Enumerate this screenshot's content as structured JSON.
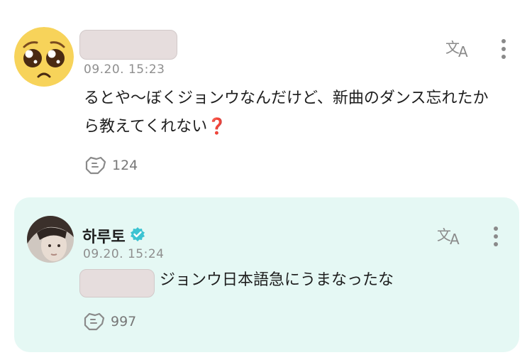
{
  "comments": [
    {
      "author_redacted": true,
      "avatar": "pleading-face-emoji",
      "timestamp": "09.20. 15:23",
      "message": "るとや〜ぼくジョンウなんだけど、新曲のダンス忘れたから教えてくれない",
      "message_emoji": "❓",
      "likes": "124",
      "icons": [
        "translate-icon",
        "more-options-icon",
        "heart-outline-icon"
      ]
    }
  ],
  "reply": {
    "author": "하루토",
    "verified": true,
    "avatar": "profile-photo",
    "timestamp": "09.20. 15:24",
    "mention_redacted": true,
    "message": "ジョンウ日本語急にうまなったな",
    "likes": "997",
    "background": "#e5f8f4",
    "icons": [
      "translate-icon",
      "more-options-icon",
      "heart-outline-icon",
      "verified-badge-icon"
    ]
  }
}
